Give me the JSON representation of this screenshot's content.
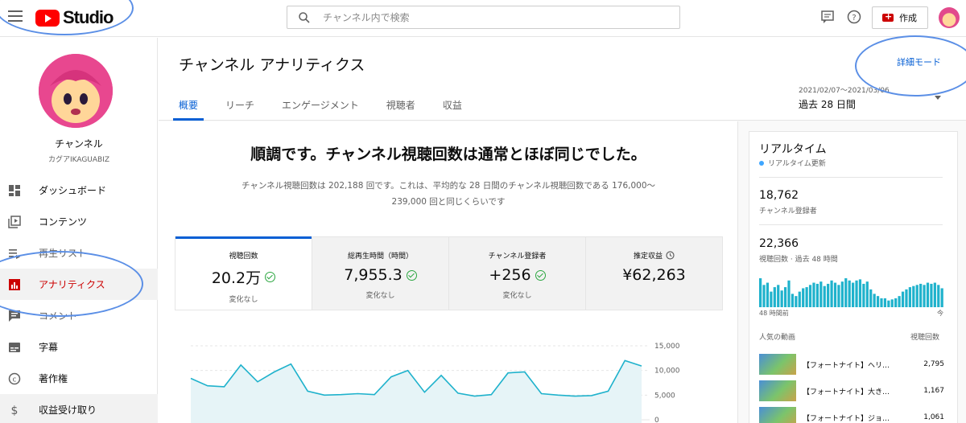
{
  "header": {
    "logo_text": "Studio",
    "search_placeholder": "チャンネル内で検索",
    "create_label": "作成",
    "icons": [
      "menu-icon",
      "feedback-icon",
      "help-icon",
      "camera-icon"
    ]
  },
  "sidebar": {
    "channel_name": "チャンネル",
    "channel_handle": "カグアIKAGUABIZ",
    "items": [
      {
        "label": "ダッシュボード",
        "icon": "dashboard-icon"
      },
      {
        "label": "コンテンツ",
        "icon": "content-icon"
      },
      {
        "label": "再生リスト",
        "icon": "playlist-icon"
      },
      {
        "label": "アナリティクス",
        "icon": "analytics-icon",
        "active": true
      },
      {
        "label": "コメント",
        "icon": "comment-icon"
      },
      {
        "label": "字幕",
        "icon": "subtitles-icon"
      },
      {
        "label": "著作権",
        "icon": "copyright-icon"
      },
      {
        "label": "収益受け取り",
        "icon": "monetization-icon"
      }
    ]
  },
  "main": {
    "title": "チャンネル アナリティクス",
    "advanced_mode": "詳細モード",
    "tabs": [
      "概要",
      "リーチ",
      "エンゲージメント",
      "視聴者",
      "収益"
    ],
    "date_range": "2021/02/07～2021/03/06",
    "date_select": "過去 28 日間",
    "headline": "順調です。チャンネル視聴回数は通常とほぼ同じでした。",
    "summary_1": "チャンネル視聴回数は 202,188 回です。これは、平均的な 28 日間のチャンネル視聴回数である 176,000～",
    "summary_2": "239,000 回と同じくらいです",
    "metrics": [
      {
        "label": "視聴回数",
        "value": "20.2万",
        "sub": "変化なし"
      },
      {
        "label": "総再生時間（時間）",
        "value": "7,955.3",
        "sub": "変化なし"
      },
      {
        "label": "チャンネル登録者",
        "value": "+256",
        "sub": "変化なし"
      },
      {
        "label": "推定収益",
        "value": "¥62,263",
        "sub": ""
      }
    ]
  },
  "chart_data": {
    "type": "area",
    "yticks": [
      "15,000",
      "10,000",
      "5,000",
      "0"
    ],
    "ylim": [
      0,
      15000
    ],
    "values": [
      8400,
      6900,
      6700,
      11100,
      7700,
      9700,
      11300,
      5800,
      5000,
      5100,
      5300,
      5100,
      8700,
      10000,
      5600,
      9000,
      5400,
      4800,
      5100,
      9500,
      9700,
      5300,
      5000,
      4800,
      4900,
      5800,
      12000,
      10900
    ]
  },
  "realtime": {
    "title": "リアルタイム",
    "live": "リアルタイム更新",
    "subs_value": "18,762",
    "subs_label": "チャンネル登録者",
    "views_value": "22,366",
    "views_label": "視聴回数 · 過去 48 時間",
    "bars": [
      26,
      20,
      22,
      14,
      18,
      20,
      15,
      18,
      24,
      12,
      10,
      14,
      17,
      18,
      20,
      22,
      21,
      23,
      19,
      21,
      24,
      22,
      20,
      23,
      26,
      24,
      22,
      24,
      25,
      21,
      23,
      16,
      12,
      10,
      8,
      8,
      6,
      7,
      8,
      10,
      14,
      16,
      18,
      19,
      20,
      21,
      20,
      22,
      21,
      22,
      20,
      17
    ],
    "axis_left": "48 時間前",
    "axis_right": "今",
    "top_videos_label": "人気の動画",
    "top_views_label": "視聴回数",
    "videos": [
      {
        "title": "【フォートナイト】ヘリ…",
        "views": "2,795"
      },
      {
        "title": "【フォートナイト】大き…",
        "views": "1,167"
      },
      {
        "title": "【フォートナイト】ジョ…",
        "views": "1,061"
      }
    ]
  }
}
